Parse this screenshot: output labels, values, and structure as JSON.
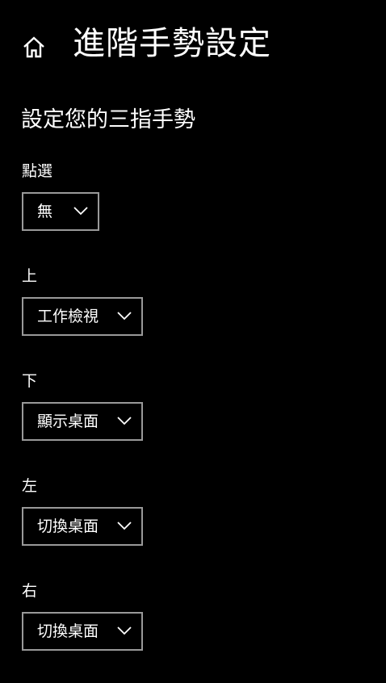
{
  "header": {
    "title": "進階手勢設定",
    "home_icon": "home-icon"
  },
  "section": {
    "title": "設定您的三指手勢"
  },
  "gestures": [
    {
      "label": "點選",
      "value": "無"
    },
    {
      "label": "上",
      "value": "工作檢視"
    },
    {
      "label": "下",
      "value": "顯示桌面"
    },
    {
      "label": "左",
      "value": "切換桌面"
    },
    {
      "label": "右",
      "value": "切換桌面"
    }
  ],
  "colors": {
    "background": "#000000",
    "text": "#ffffff",
    "dropdown_border": "#999999"
  }
}
